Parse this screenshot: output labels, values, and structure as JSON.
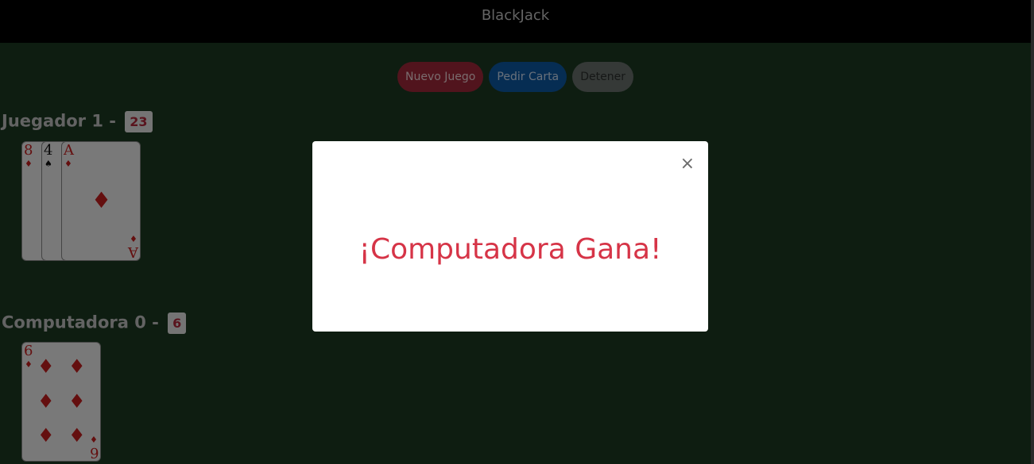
{
  "header": {
    "title": "BlackJack"
  },
  "controls": {
    "new_game": "Nuevo Juego",
    "hit": "Pedir Carta",
    "stand": "Detener"
  },
  "player": {
    "label": "Juegador 1 -",
    "score": "23",
    "cards": [
      {
        "rank": "8",
        "suit": "♦"
      },
      {
        "rank": "4",
        "suit": "♠"
      },
      {
        "rank": "A",
        "suit": "♦"
      }
    ]
  },
  "computer": {
    "label": "Computadora 0 -",
    "score": "6",
    "cards": [
      {
        "rank": "6",
        "suit": "♦"
      }
    ]
  },
  "modal": {
    "close": "×",
    "message": "¡Computadora Gana!"
  },
  "colors": {
    "table": "#1d3a23",
    "message": "#d63447",
    "score": "#b2283a"
  }
}
